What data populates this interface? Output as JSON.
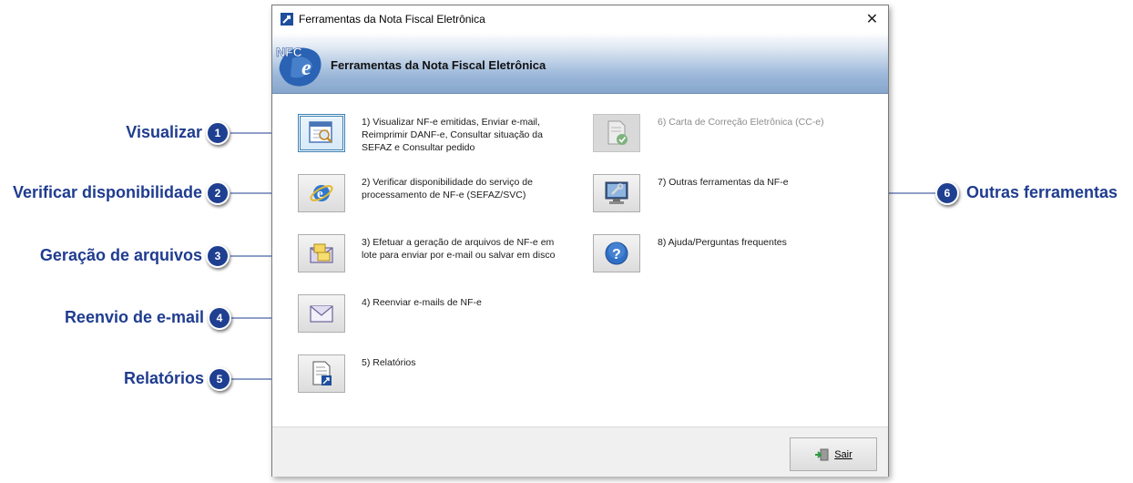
{
  "window": {
    "title": "Ferramentas da Nota Fiscal Eletrônica",
    "close_glyph": "✕"
  },
  "banner": {
    "logo_text": "NFC",
    "logo_letter": "e",
    "title": "Ferramentas da Nota Fiscal Eletrônica"
  },
  "tools": [
    {
      "label": "1) Visualizar NF-e emitidas, Enviar e-mail, Reimprimir DANF-e, Consultar situação da SEFAZ e Consultar pedido",
      "icon": "view-document-icon",
      "enabled": true
    },
    {
      "label": "2) Verificar disponibilidade do serviço de processamento de NF-e (SEFAZ/SVC)",
      "icon": "internet-explorer-icon",
      "enabled": true
    },
    {
      "label": "3) Efetuar a geração de arquivos de NF-e em lote para enviar por e-mail ou salvar em disco",
      "icon": "envelope-files-icon",
      "enabled": true
    },
    {
      "label": "4) Reenviar e-mails de NF-e",
      "icon": "envelope-icon",
      "enabled": true
    },
    {
      "label": "5) Relatórios",
      "icon": "report-icon",
      "enabled": true
    },
    {
      "label": "6) Carta de Correção Eletrônica (CC-e)",
      "icon": "correction-letter-icon",
      "enabled": false
    },
    {
      "label": "7) Outras ferramentas da NF-e",
      "icon": "computer-tools-icon",
      "enabled": true
    },
    {
      "label": "8) Ajuda/Perguntas frequentes",
      "icon": "help-icon",
      "enabled": true
    }
  ],
  "footer": {
    "exit_label": "Sair",
    "exit_icon": "exit-door-icon"
  },
  "callouts": [
    {
      "number": "1",
      "label": "Visualizar"
    },
    {
      "number": "2",
      "label": "Verificar disponibilidade"
    },
    {
      "number": "3",
      "label": "Geração de arquivos"
    },
    {
      "number": "4",
      "label": "Reenvio de e-mail"
    },
    {
      "number": "5",
      "label": "Relatórios"
    },
    {
      "number": "6",
      "label": "Outras ferramentas"
    }
  ],
  "colors": {
    "callout_text": "#1f3c8f",
    "badge_fill": "#1f3f91",
    "banner_gradient_end": "#87a6cd",
    "disabled_text": "#8c8c8c"
  }
}
